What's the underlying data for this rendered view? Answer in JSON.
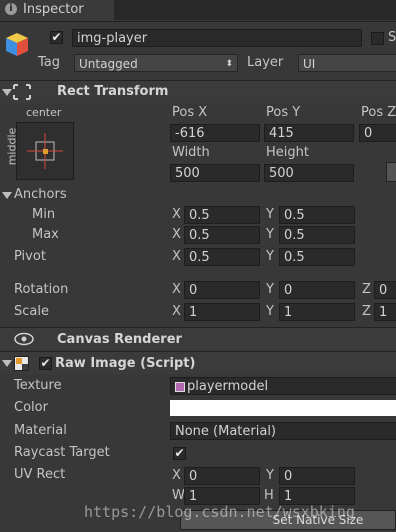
{
  "tab": {
    "title": "Inspector"
  },
  "object": {
    "name": "img-player",
    "active": true,
    "static_label": "S",
    "tag_label": "Tag",
    "tag_value": "Untagged",
    "layer_label": "Layer",
    "layer_value": "UI"
  },
  "rect_transform": {
    "title": "Rect Transform",
    "anchor_preset_top": "center",
    "anchor_preset_side": "middle",
    "pos_x_label": "Pos X",
    "pos_y_label": "Pos Y",
    "pos_z_label": "Pos Z",
    "pos_x": "-616",
    "pos_y": "415",
    "pos_z": "0",
    "width_label": "Width",
    "height_label": "Height",
    "width": "500",
    "height": "500",
    "anchors_label": "Anchors",
    "min_label": "Min",
    "max_label": "Max",
    "min_x": "0.5",
    "min_y": "0.5",
    "max_x": "0.5",
    "max_y": "0.5",
    "pivot_label": "Pivot",
    "pivot_x": "0.5",
    "pivot_y": "0.5",
    "rotation_label": "Rotation",
    "rot_x": "0",
    "rot_y": "0",
    "rot_z": "0",
    "scale_label": "Scale",
    "scale_x": "1",
    "scale_y": "1",
    "scale_z": "1",
    "x_label": "X",
    "y_label": "Y",
    "z_label": "Z"
  },
  "canvas_renderer": {
    "title": "Canvas Renderer"
  },
  "raw_image": {
    "title": "Raw Image (Script)",
    "enabled": true,
    "texture_label": "Texture",
    "texture_value": "playermodel",
    "color_label": "Color",
    "color_value": "#ffffff",
    "material_label": "Material",
    "material_value": "None (Material)",
    "raycast_label": "Raycast Target",
    "raycast_checked": true,
    "uv_label": "UV Rect",
    "uv_x_label": "X",
    "uv_x": "0",
    "uv_y_label": "Y",
    "uv_y": "0",
    "uv_w_label": "W",
    "uv_w": "1",
    "uv_h_label": "H",
    "uv_h": "1",
    "native_size_label": "Set Native Size"
  },
  "watermark": "https://blog.csdn.net/wsxbking",
  "colors": {
    "bg": "#383838",
    "field": "#2a2a2a",
    "color_swatch": "#ffffff"
  }
}
